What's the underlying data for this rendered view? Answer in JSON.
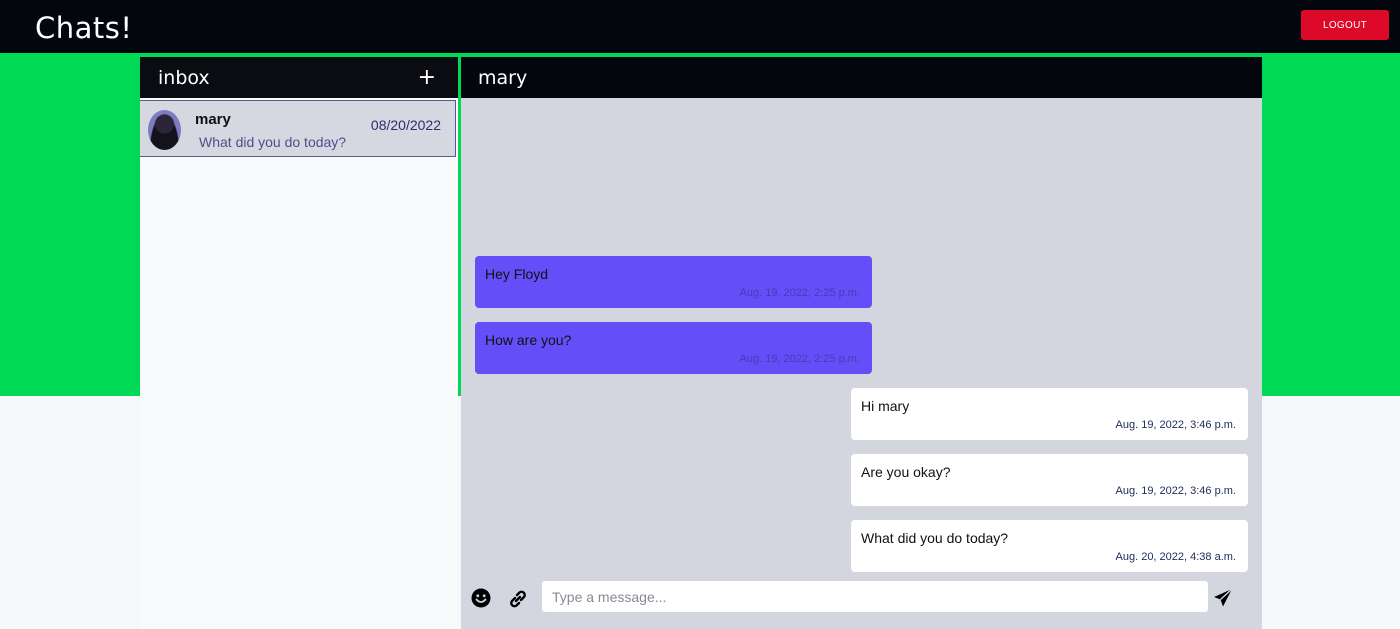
{
  "app": {
    "brand": "Chats!",
    "logout_label": "LOGOUT"
  },
  "colors": {
    "topbar": "#04060d",
    "accent_green": "#00d955",
    "logout_red": "#dc0a28",
    "incoming_bubble": "#634ef8",
    "outgoing_bubble": "#ffffff",
    "chat_background": "#d3d6df"
  },
  "inbox": {
    "title": "inbox",
    "add_icon": "plus-icon",
    "add_label": "+",
    "conversations": [
      {
        "name": "mary",
        "date": "08/20/2022",
        "preview": "What did you do today?",
        "avatar": "avatar-photo"
      }
    ]
  },
  "chat": {
    "title": "mary",
    "messages": [
      {
        "direction": "incoming",
        "text": "Hey Floyd",
        "time": "Aug. 19, 2022, 2:25 p.m."
      },
      {
        "direction": "incoming",
        "text": "How are you?",
        "time": "Aug. 19, 2022, 2:25 p.m."
      },
      {
        "direction": "outgoing",
        "text": "Hi mary",
        "time": "Aug. 19, 2022, 3:46 p.m."
      },
      {
        "direction": "outgoing",
        "text": "Are you okay?",
        "time": "Aug. 19, 2022, 3:46 p.m."
      },
      {
        "direction": "outgoing",
        "text": "What did you do today?",
        "time": "Aug. 20, 2022, 4:38 a.m."
      }
    ],
    "composer": {
      "placeholder": "Type a message...",
      "value": "",
      "emoji_icon": "smiley-icon",
      "attach_icon": "link-icon",
      "send_icon": "paper-plane-icon"
    }
  }
}
